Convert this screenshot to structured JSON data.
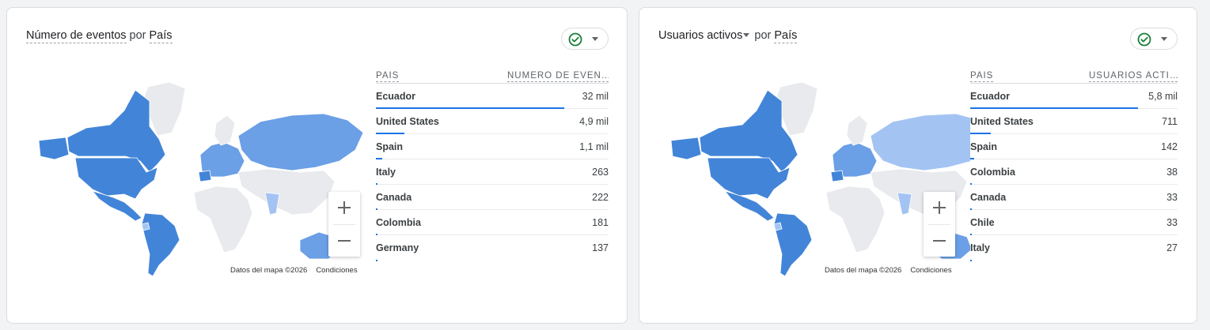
{
  "colors": {
    "accent": "#1a73e8",
    "map_dark": "#4285d8",
    "map_mid": "#6b9fe6",
    "map_light": "#a3c4f3",
    "map_none": "#e8eaed",
    "success": "#188038"
  },
  "cards": [
    {
      "title_metric": "Número de eventos",
      "title_connector": "por",
      "title_dimension": "País",
      "status_icon": "check-circle-icon",
      "map_attribution": "Datos del mapa ©2026",
      "map_terms": "Condiciones",
      "table": {
        "col_dimension": "PAÍS",
        "col_metric": "NÚMERO DE EVEN…",
        "rows": [
          {
            "country": "Ecuador",
            "value": "32 mil",
            "share": 1.0
          },
          {
            "country": "United States",
            "value": "4,9 mil",
            "share": 0.153
          },
          {
            "country": "Spain",
            "value": "1,1 mil",
            "share": 0.034
          },
          {
            "country": "Italy",
            "value": "263",
            "share": 0.008
          },
          {
            "country": "Canada",
            "value": "222",
            "share": 0.007
          },
          {
            "country": "Colombia",
            "value": "181",
            "share": 0.006
          },
          {
            "country": "Germany",
            "value": "137",
            "share": 0.004
          }
        ]
      }
    },
    {
      "title_metric": "Usuarios activos",
      "title_connector": "por",
      "title_dimension": "País",
      "status_icon": "check-circle-icon",
      "map_attribution": "Datos del mapa ©2026",
      "map_terms": "Condiciones",
      "table": {
        "col_dimension": "PAÍS",
        "col_metric": "USUARIOS ACTI…",
        "rows": [
          {
            "country": "Ecuador",
            "value": "5,8 mil",
            "share": 1.0
          },
          {
            "country": "United States",
            "value": "711",
            "share": 0.123
          },
          {
            "country": "Spain",
            "value": "142",
            "share": 0.024
          },
          {
            "country": "Colombia",
            "value": "38",
            "share": 0.007
          },
          {
            "country": "Canada",
            "value": "33",
            "share": 0.006
          },
          {
            "country": "Chile",
            "value": "33",
            "share": 0.006
          },
          {
            "country": "Italy",
            "value": "27",
            "share": 0.005
          }
        ]
      }
    }
  ]
}
